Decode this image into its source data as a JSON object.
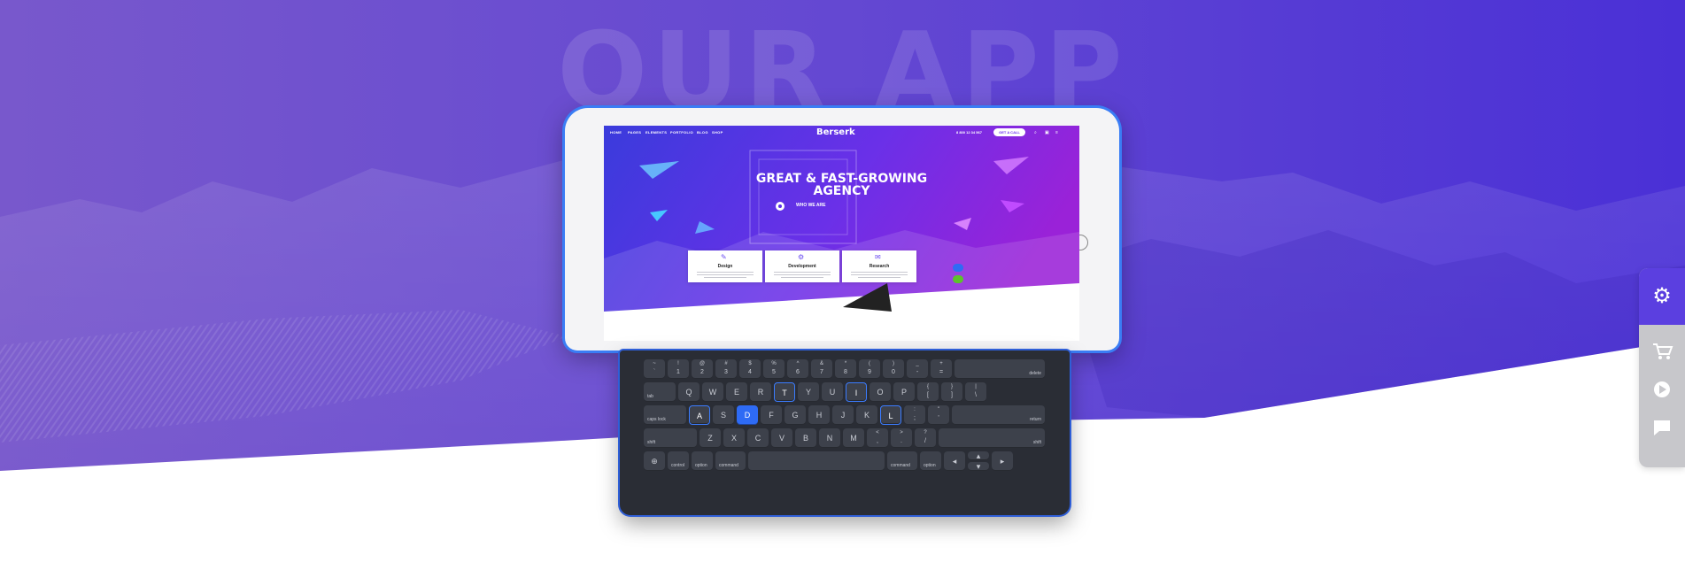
{
  "hero": {
    "ghost_title": "OUR APP"
  },
  "site": {
    "nav": [
      "HOME",
      "PAGES",
      "ELEMENTS",
      "PORTFOLIO",
      "BLOG",
      "SHOP"
    ],
    "logo": "Berserk",
    "phone": "8 800 12 34 567",
    "cta": "GET A CALL",
    "headline_line1": "GREAT & FAST-GROWING",
    "headline_line2": "AGENCY",
    "who_we_are": "WHO WE ARE",
    "cards": [
      {
        "title": "Design"
      },
      {
        "title": "Development"
      },
      {
        "title": "Research"
      }
    ]
  },
  "keyboard": {
    "row1": [
      {
        "top": "~",
        "bot": "`"
      },
      {
        "top": "!",
        "bot": "1"
      },
      {
        "top": "@",
        "bot": "2"
      },
      {
        "top": "#",
        "bot": "3"
      },
      {
        "top": "$",
        "bot": "4"
      },
      {
        "top": "%",
        "bot": "5"
      },
      {
        "top": "^",
        "bot": "6"
      },
      {
        "top": "&",
        "bot": "7"
      },
      {
        "top": "*",
        "bot": "8"
      },
      {
        "top": "(",
        "bot": "9"
      },
      {
        "top": ")",
        "bot": "0"
      },
      {
        "top": "_",
        "bot": "-"
      },
      {
        "top": "+",
        "bot": "="
      }
    ],
    "delete": "delete",
    "tab": "tab",
    "row2": [
      "Q",
      "W",
      "E",
      "R",
      "T",
      "Y",
      "U",
      "I",
      "O",
      "P"
    ],
    "row2_sym": [
      {
        "top": "{",
        "bot": "["
      },
      {
        "top": "}",
        "bot": "]"
      },
      {
        "top": "|",
        "bot": "\\"
      }
    ],
    "caps": "caps lock",
    "row3": [
      "A",
      "S",
      "D",
      "F",
      "G",
      "H",
      "J",
      "K",
      "L"
    ],
    "row3_sym": [
      {
        "top": ":",
        "bot": ";"
      },
      {
        "top": "\"",
        "bot": "'"
      }
    ],
    "return": "return",
    "shift": "shift",
    "row4": [
      "Z",
      "X",
      "C",
      "V",
      "B",
      "N",
      "M"
    ],
    "row4_sym": [
      {
        "top": "<",
        "bot": ","
      },
      {
        "top": ">",
        "bot": "."
      },
      {
        "top": "?",
        "bot": "/"
      }
    ],
    "control": "control",
    "option": "option",
    "command": "command",
    "highlighted_keys": [
      "A",
      "T",
      "I",
      "L"
    ],
    "active_key": "D"
  },
  "colors": {
    "hero_left": "#7a5bd0",
    "hero_right": "#4a2fd4",
    "accent": "#2e6bf5",
    "widget_top": "#5b3fe0"
  },
  "side_widget": {
    "icons": [
      "gear-icon",
      "cart-icon",
      "play-icon",
      "chat-icon"
    ]
  }
}
